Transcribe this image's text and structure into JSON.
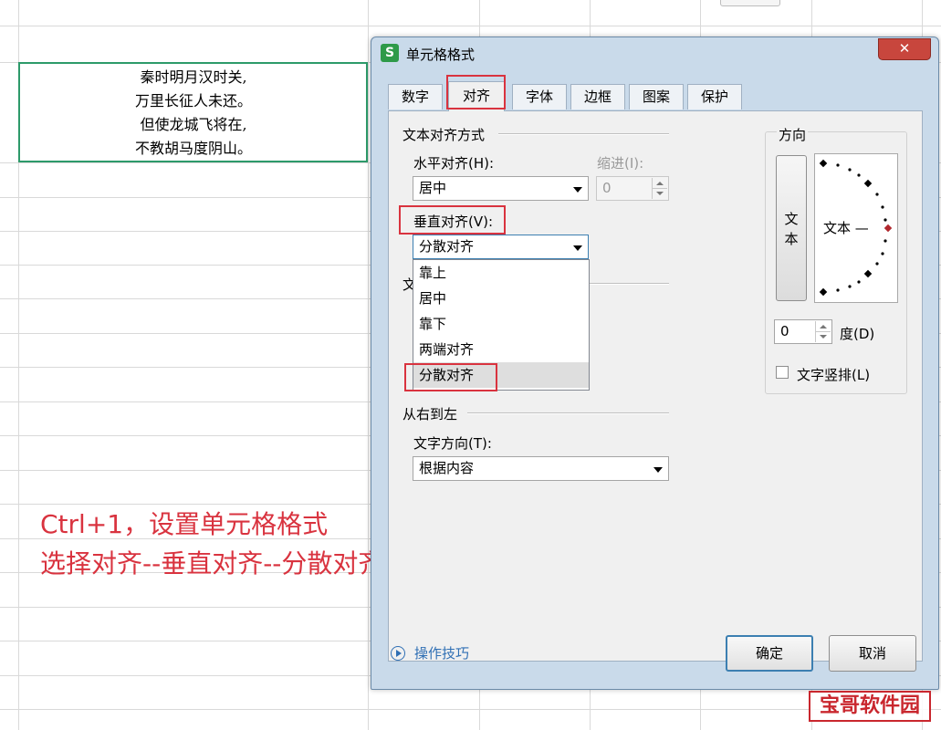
{
  "spreadsheet": {
    "poem_lines": [
      "秦时明月汉时关,",
      "万里长征人未还。",
      "但使龙城飞将在,",
      "不教胡马度阴山。"
    ]
  },
  "annotation": {
    "line1": "Ctrl+1，设置单元格格式",
    "line2": "选择对齐--垂直对齐--分散对齐",
    "color": "#d9333f"
  },
  "dialog": {
    "app_icon": "S",
    "title": "单元格格式",
    "close_label": "✕",
    "tabs": [
      {
        "label": "数字"
      },
      {
        "label": "对齐",
        "active": true
      },
      {
        "label": "字体"
      },
      {
        "label": "边框"
      },
      {
        "label": "图案"
      },
      {
        "label": "保护"
      }
    ],
    "text_align": {
      "group_title": "文本对齐方式",
      "horizontal_label": "水平对齐(H):",
      "horizontal_value": "居中",
      "indent_label": "缩进(I):",
      "indent_value": "0",
      "vertical_label": "垂直对齐(V):",
      "vertical_value": "分散对齐",
      "vertical_options": [
        "靠上",
        "居中",
        "靠下",
        "两端对齐",
        "分散对齐"
      ],
      "hidden_group_letter": "文"
    },
    "rtl": {
      "group_title": "从右到左",
      "direction_label": "文字方向(T):",
      "direction_value": "根据内容"
    },
    "orientation": {
      "group_title": "方向",
      "vertical_text": [
        "文",
        "本"
      ],
      "dial_text": "文本 —",
      "degrees_value": "0",
      "degrees_label": "度(D)",
      "stacked_label": "文字竖排(L)"
    },
    "footer": {
      "tips_label": "操作技巧",
      "ok_label": "确定",
      "cancel_label": "取消"
    }
  },
  "watermark": "宝哥软件园"
}
